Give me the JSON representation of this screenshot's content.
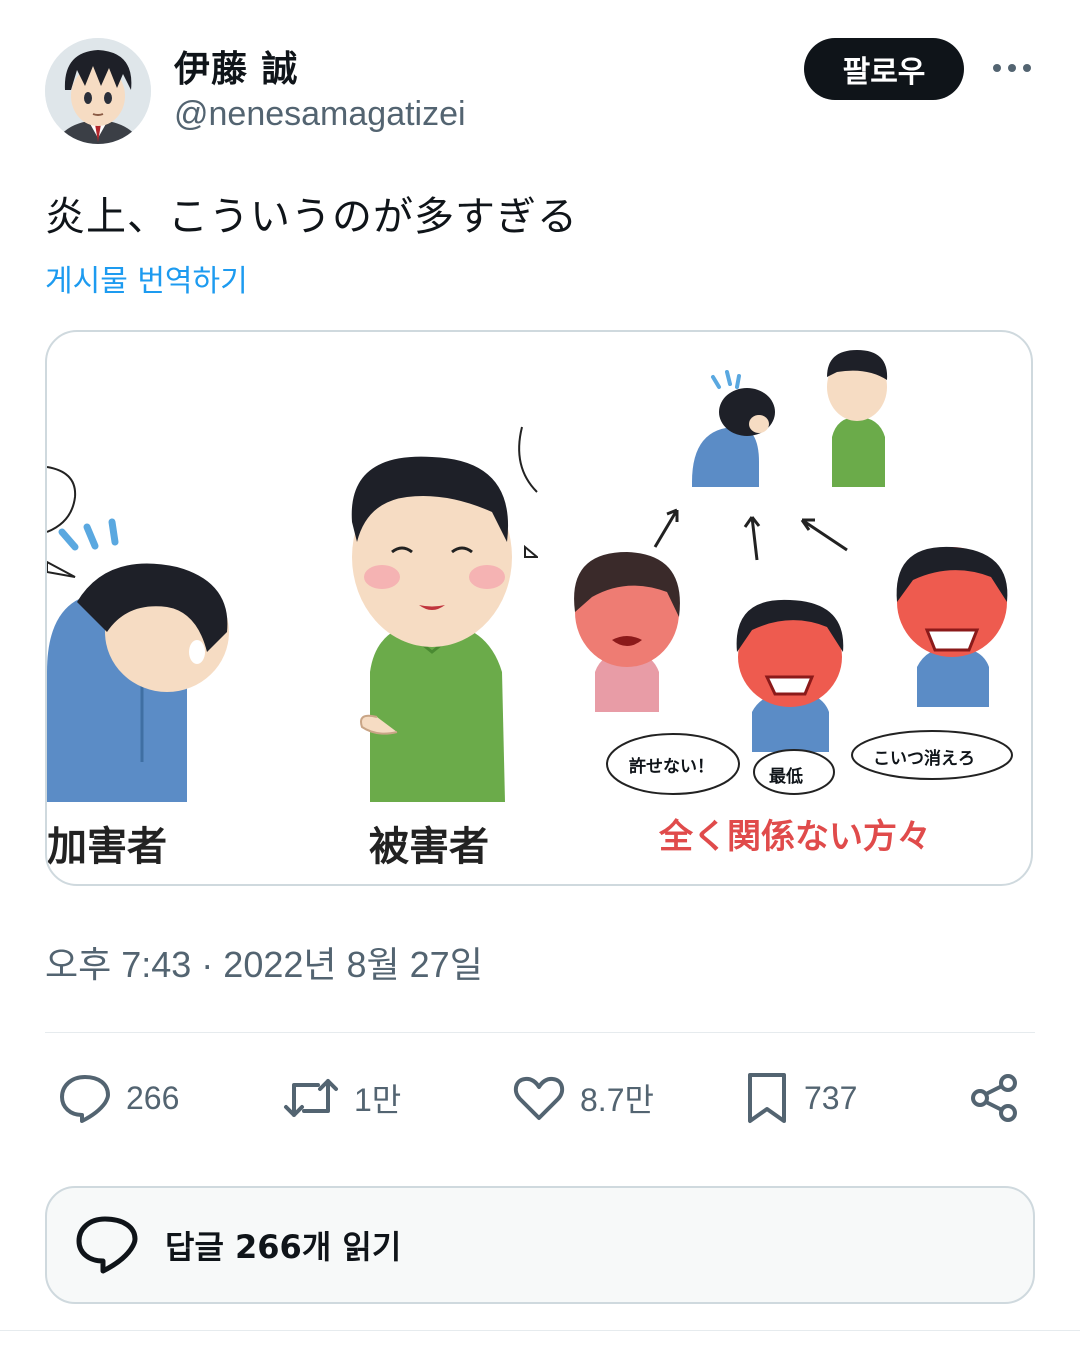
{
  "author": {
    "display_name": "伊藤 誠",
    "handle": "@nenesamagatizei",
    "avatar_icon": "user-avatar"
  },
  "follow_label": "팔로우",
  "tweet": {
    "text": "炎上、こういうのが多すぎる",
    "translate_label": "게시물 번역하기"
  },
  "media": {
    "captions": {
      "left": "加害者",
      "middle": "被害者",
      "right": "全く関係ない方々"
    },
    "bubbles": [
      "許せない！",
      "最低",
      "こいつ消えろ"
    ]
  },
  "timestamp": "오후 7:43 · 2022년 8월 27일",
  "actions": {
    "replies": "266",
    "retweets": "1만",
    "likes": "8.7만",
    "bookmarks": "737"
  },
  "read_replies_label": "답글 266개 읽기",
  "colors": {
    "accent": "#1d9bf0",
    "text": "#0f1419",
    "muted": "#536471",
    "border": "#cfd9de",
    "caption_red": "#e04b4b"
  }
}
